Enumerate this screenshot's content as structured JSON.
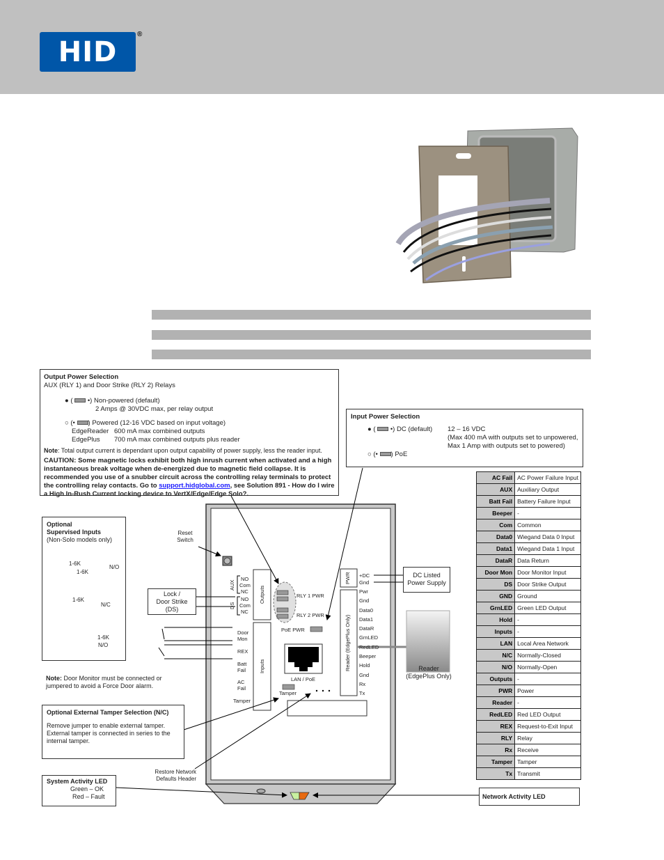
{
  "header": {
    "logo_text": "HID",
    "registered_mark": "®"
  },
  "output_power": {
    "title": "Output Power Selection",
    "subtitle": "AUX (RLY 1) and Door Strike (RLY 2) Relays",
    "option1_label": "Non-powered (default)",
    "option1_detail": "2 Amps @ 30VDC max, per relay output",
    "option2_label": "Powered  (12-16 VDC based on input voltage)",
    "edgereader_label": "EdgeReader",
    "edgereader_value": "600 mA max combined outputs",
    "edgeplus_label": "EdgePlus",
    "edgeplus_value": "700 mA max combined outputs plus reader",
    "note_label": "Note",
    "note_text": ": Total output current is dependant upon output capability of power supply, less the reader input.",
    "caution_text_1": "CAUTION: Some magnetic locks exhibit both high inrush current when activated and a high instantaneous break voltage when de-energized due to magnetic field collapse. It is recommended you use of a snubber circuit across the controlling relay terminals to protect the controlling relay contacts.  Go to ",
    "caution_link": "support.hidglobal.com",
    "caution_text_2": ", see Solution 891 - How do I wire a High In-Rush Current locking device to VertX/Edge/Edge Solo?."
  },
  "input_power": {
    "title": "Input Power Selection",
    "option1_label": "DC (default)",
    "option1_value": "12 – 16 VDC",
    "option1_detail_1": "(Max  400 mA with outputs set to unpowered,",
    "option1_detail_2": " Max 1 Amp with outputs set to powered)",
    "option2_label": "PoE"
  },
  "supervised_inputs": {
    "title_1": "Optional",
    "title_2": "Supervised Inputs",
    "subtitle": "(Non-Solo models only)",
    "resistor": "1-6K",
    "no_label": "N/O",
    "nc_label": "N/C"
  },
  "door_monitor_note": {
    "label": "Note:",
    "text": " Door Monitor must be connected or jumpered to avoid a Force Door alarm."
  },
  "tamper_box": {
    "title": "Optional External Tamper Selection (N/C)",
    "text": "Remove jumper to enable external tamper. External tamper is connected in series to the internal tamper."
  },
  "system_led": {
    "title": "System Activity LED",
    "line1": "Green – OK",
    "line2": "Red – Fault"
  },
  "network_led": {
    "title": "Network Activity LED"
  },
  "diagram": {
    "reset_switch": "Reset Switch",
    "lock_box_1": "Lock /",
    "lock_box_2": "Door Strike",
    "lock_box_3": "(DS)",
    "aux": "AUX",
    "ds": "DS",
    "no": "NO",
    "com": "Com",
    "nc": "NC",
    "outputs": "Outputs",
    "inputs": "Inputs",
    "input_terms": [
      "Door Mon",
      "REX",
      "Batt Fail",
      "AC Fail",
      "Tamper"
    ],
    "rly1": "RLY 1 PWR",
    "rly2": "RLY 2 PWR",
    "poe_pwr": "PoE PWR",
    "lan_poe": "LAN / PoE",
    "tamper": "Tamper",
    "restore": "Restore Network Defaults Header",
    "pwr": "PWR",
    "dc": "+DC",
    "gnd": "Gnd",
    "reader_block": "Reader (EdgePlus Only)",
    "reader_terms": [
      "Pwr",
      "Gnd",
      "Data0",
      "Data1",
      "DataR",
      "GrnLED",
      "RedLED",
      "Beeper",
      "Hold",
      "Gnd",
      "Rx",
      "Tx"
    ],
    "power_supply_1": "DC Listed",
    "power_supply_2": "Power Supply",
    "reader_1": "Reader",
    "reader_2": "(EdgePlus Only)"
  },
  "legend": [
    {
      "k": "AC Fail",
      "v": "AC Power Failure Input"
    },
    {
      "k": "AUX",
      "v": "Auxiliary Output"
    },
    {
      "k": "Batt Fail",
      "v": "Battery Failure Input"
    },
    {
      "k": "Beeper",
      "v": "-"
    },
    {
      "k": "Com",
      "v": "Common"
    },
    {
      "k": "Data0",
      "v": "Wiegand Data 0 Input"
    },
    {
      "k": "Data1",
      "v": "Wiegand Data 1 Input"
    },
    {
      "k": "DataR",
      "v": "Data Return"
    },
    {
      "k": "Door Mon",
      "v": "Door Monitor Input"
    },
    {
      "k": "DS",
      "v": "Door Strike Output"
    },
    {
      "k": "GND",
      "v": "Ground"
    },
    {
      "k": "GrnLED",
      "v": "Green LED Output"
    },
    {
      "k": "Hold",
      "v": "-"
    },
    {
      "k": "Inputs",
      "v": "-"
    },
    {
      "k": "LAN",
      "v": "Local Area Network"
    },
    {
      "k": "N/C",
      "v": "Normally-Closed"
    },
    {
      "k": "N/O",
      "v": "Normally-Open"
    },
    {
      "k": "Outputs",
      "v": "-"
    },
    {
      "k": "PWR",
      "v": "Power"
    },
    {
      "k": "Reader",
      "v": "-"
    },
    {
      "k": "RedLED",
      "v": "Red LED Output"
    },
    {
      "k": "REX",
      "v": "Request-to-Exit Input"
    },
    {
      "k": "RLY",
      "v": "Relay"
    },
    {
      "k": "Rx",
      "v": "Receive"
    },
    {
      "k": "Tamper",
      "v": "Tamper"
    },
    {
      "k": "Tx",
      "v": "Transmit"
    }
  ],
  "colors": {
    "brand_blue": "#0056a8",
    "header_gray": "#c0c0c0",
    "led_green": "#c8f0a0",
    "led_orange": "#e86a10"
  }
}
